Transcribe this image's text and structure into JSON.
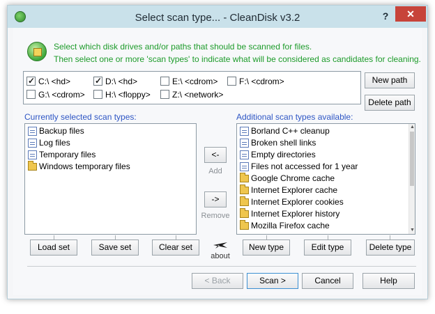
{
  "window": {
    "title": "Select scan type... - CleanDisk v3.2",
    "help_glyph": "?",
    "close_glyph": "✕"
  },
  "info": {
    "line1": "Select which disk drives and/or paths that should be scanned for files.",
    "line2": "Then select one or more 'scan types' to indicate what will be considered as candidates for cleaning."
  },
  "drives": [
    {
      "label": "C:\\ <hd>",
      "checked": true
    },
    {
      "label": "D:\\ <hd>",
      "checked": true
    },
    {
      "label": "E:\\ <cdrom>",
      "checked": false
    },
    {
      "label": "F:\\ <cdrom>",
      "checked": false
    },
    {
      "label": "G:\\ <cdrom>",
      "checked": false
    },
    {
      "label": "H:\\ <floppy>",
      "checked": false
    },
    {
      "label": "Z:\\ <network>",
      "checked": false
    }
  ],
  "path_buttons": {
    "new_path": "New path",
    "delete_path": "Delete path"
  },
  "selected": {
    "label": "Currently selected scan types:",
    "items": [
      {
        "label": "Backup files",
        "icon": "file-icon"
      },
      {
        "label": "Log files",
        "icon": "file-icon"
      },
      {
        "label": "Temporary files",
        "icon": "file-icon"
      },
      {
        "label": "Windows temporary files",
        "icon": "folder-icon"
      }
    ]
  },
  "available": {
    "label": "Additional scan types available:",
    "items": [
      {
        "label": "Borland C++ cleanup",
        "icon": "file-icon"
      },
      {
        "label": "Broken shell links",
        "icon": "file-icon"
      },
      {
        "label": "Empty directories",
        "icon": "file-icon"
      },
      {
        "label": "Files not accessed for 1 year",
        "icon": "file-icon"
      },
      {
        "label": "Google Chrome cache",
        "icon": "folder-icon"
      },
      {
        "label": "Internet Explorer cache",
        "icon": "folder-icon"
      },
      {
        "label": "Internet Explorer cookies",
        "icon": "folder-icon"
      },
      {
        "label": "Internet Explorer history",
        "icon": "folder-icon"
      },
      {
        "label": "Mozilla Firefox cache",
        "icon": "folder-icon"
      }
    ]
  },
  "transfer": {
    "add_glyph": "<-",
    "add_label": "Add",
    "remove_glyph": "->",
    "remove_label": "Remove"
  },
  "set_buttons": {
    "load": "Load set",
    "save": "Save set",
    "clear": "Clear set"
  },
  "type_buttons": {
    "new": "New type",
    "edit": "Edit type",
    "delete": "Delete type"
  },
  "about_label": "about",
  "footer": {
    "back": "< Back",
    "scan": "Scan >",
    "cancel": "Cancel",
    "help": "Help"
  },
  "colors": {
    "info_text": "#1d9b2a",
    "section_label": "#2d55c4",
    "close_button": "#c7443a",
    "titlebar": "#c9e1ea"
  }
}
